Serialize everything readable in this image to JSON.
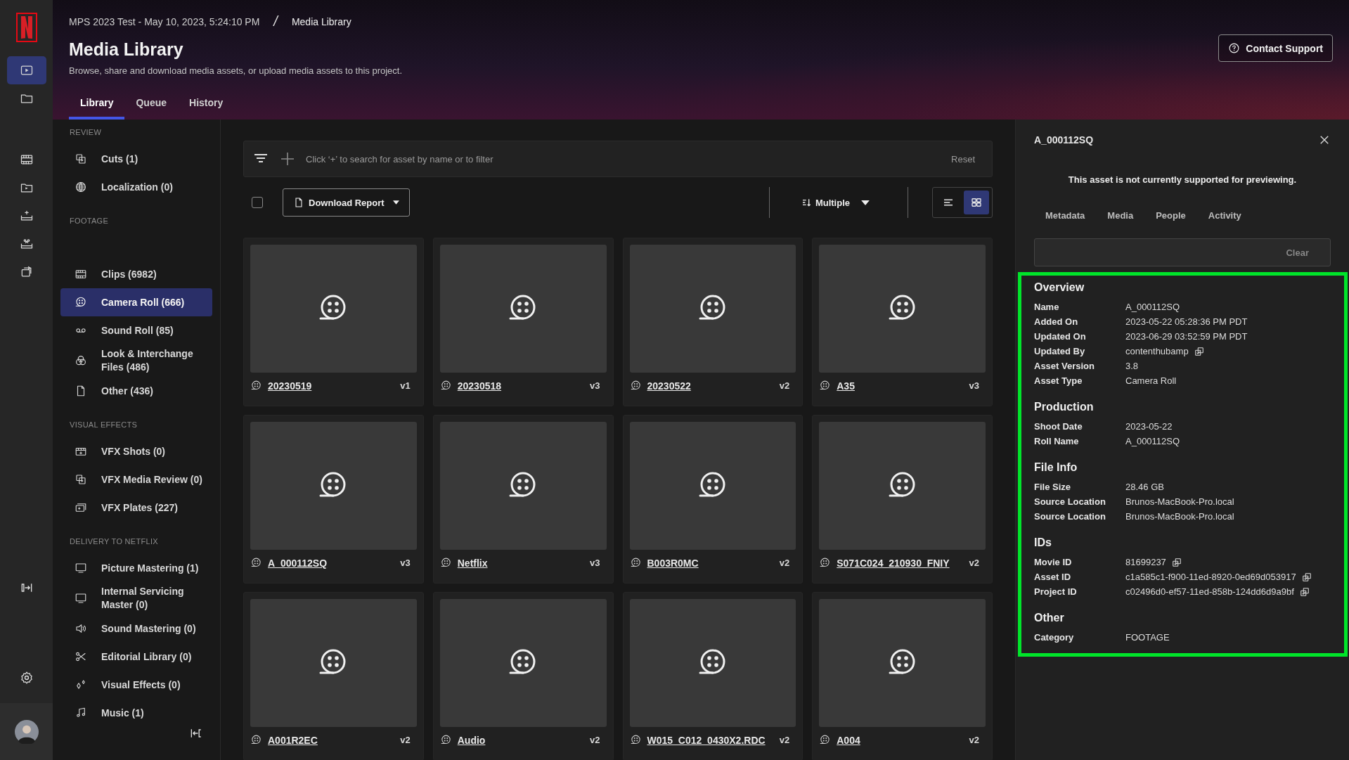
{
  "rail": {
    "items": [
      {
        "kind": "media",
        "selected": true
      },
      {
        "kind": "folder",
        "selected": false
      },
      {
        "kind": "film",
        "selected": false
      },
      {
        "kind": "folder-play",
        "selected": false
      },
      {
        "kind": "tray-sparkle",
        "selected": false
      },
      {
        "kind": "tray-scissors",
        "selected": false
      },
      {
        "kind": "export",
        "selected": false
      }
    ]
  },
  "breadcrumb": {
    "project": "MPS 2023 Test - May 10, 2023, 5:24:10 PM",
    "separator": "/",
    "current": "Media Library"
  },
  "header": {
    "title": "Media Library",
    "subtitle": "Browse, share and download media assets, or upload media assets to this project.",
    "contact_button": "Contact Support"
  },
  "tabs": [
    {
      "label": "Library",
      "selected": true
    },
    {
      "label": "Queue",
      "selected": false
    },
    {
      "label": "History",
      "selected": false
    }
  ],
  "sidebar": {
    "sections": [
      {
        "heading": "REVIEW",
        "items": [
          {
            "label": "Cuts (1)",
            "kind": "cuts",
            "selected": false
          },
          {
            "label": "Localization (0)",
            "kind": "globe",
            "selected": false
          }
        ]
      },
      {
        "heading": "FOOTAGE",
        "items": [
          {
            "label": "Clips (6982)",
            "kind": "film",
            "selected": false
          },
          {
            "label": "Camera Roll (666)",
            "kind": "reel",
            "selected": true
          },
          {
            "label": "Sound Roll (85)",
            "kind": "tape",
            "selected": false
          },
          {
            "label": "Look & Interchange Files (486)",
            "kind": "circles",
            "selected": false
          },
          {
            "label": "Other (436)",
            "kind": "file",
            "selected": false
          }
        ]
      },
      {
        "heading": "VISUAL EFFECTS",
        "items": [
          {
            "label": "VFX Shots (0)",
            "kind": "clapper",
            "selected": false
          },
          {
            "label": "VFX Media Review (0)",
            "kind": "cuts",
            "selected": false
          },
          {
            "label": "VFX Plates (227)",
            "kind": "plates",
            "selected": false
          }
        ]
      },
      {
        "heading": "DELIVERY TO NETFLIX",
        "items": [
          {
            "label": "Picture Mastering (1)",
            "kind": "monitor",
            "selected": false
          },
          {
            "label": "Internal Servicing Master (0)",
            "kind": "monitor",
            "selected": false
          },
          {
            "label": "Sound Mastering (0)",
            "kind": "speaker",
            "selected": false
          },
          {
            "label": "Editorial Library (0)",
            "kind": "scissors",
            "selected": false
          },
          {
            "label": "Visual Effects (0)",
            "kind": "sparkle",
            "selected": false
          },
          {
            "label": "Music (1)",
            "kind": "music",
            "selected": false
          }
        ]
      }
    ]
  },
  "filter_bar": {
    "placeholder": "Click ‘+’ to search for asset by name or to filter",
    "reset": "Reset"
  },
  "toolbar": {
    "select_all": {
      "checked": false
    },
    "download": "Download Report",
    "sort": "Multiple",
    "views": [
      {
        "kind": "list",
        "selected": false
      },
      {
        "kind": "grid",
        "selected": true
      }
    ]
  },
  "assets": [
    {
      "name": "20230519",
      "version": "v1"
    },
    {
      "name": "20230518",
      "version": "v3"
    },
    {
      "name": "20230522",
      "version": "v2"
    },
    {
      "name": "A35",
      "version": "v3"
    },
    {
      "name": "A_000112SQ",
      "version": "v3"
    },
    {
      "name": "Netflix",
      "version": "v3"
    },
    {
      "name": "B003R0MC",
      "version": "v2"
    },
    {
      "name": "S071C024_210930_FNIY",
      "version": "v2"
    },
    {
      "name": "A001R2EC",
      "version": "v2"
    },
    {
      "name": "Audio",
      "version": "v2"
    },
    {
      "name": "W015_C012_0430X2.RDC",
      "version": "v2"
    },
    {
      "name": "A004",
      "version": "v2"
    }
  ],
  "details": {
    "title": "A_000112SQ",
    "notice": "This asset is not currently supported for previewing.",
    "tabs": [
      "Metadata",
      "Media",
      "People",
      "Activity"
    ],
    "clear": "Clear",
    "sections": [
      {
        "heading": "Overview",
        "rows": [
          {
            "label": "Name",
            "value": "A_000112SQ",
            "copyable": false
          },
          {
            "label": "Added On",
            "value": "2023-05-22 05:28:36 PM PDT",
            "copyable": false
          },
          {
            "label": "Updated On",
            "value": "2023-06-29 03:52:59 PM PDT",
            "copyable": false
          },
          {
            "label": "Updated By",
            "value": "contenthubamp",
            "copyable": true
          },
          {
            "label": "Asset Version",
            "value": "3.8",
            "copyable": false
          },
          {
            "label": "Asset Type",
            "value": "Camera Roll",
            "copyable": false
          }
        ]
      },
      {
        "heading": "Production",
        "rows": [
          {
            "label": "Shoot Date",
            "value": "2023-05-22",
            "copyable": false
          },
          {
            "label": "Roll Name",
            "value": "A_000112SQ",
            "copyable": false
          }
        ]
      },
      {
        "heading": "File Info",
        "rows": [
          {
            "label": "File Size",
            "value": "28.46 GB",
            "copyable": false
          },
          {
            "label": "Source Location",
            "value": "Brunos-MacBook-Pro.local",
            "copyable": false
          },
          {
            "label": "Source Location",
            "value": "Brunos-MacBook-Pro.local",
            "copyable": false
          }
        ]
      },
      {
        "heading": "IDs",
        "rows": [
          {
            "label": "Movie ID",
            "value": "81699237",
            "copyable": true
          },
          {
            "label": "Asset ID",
            "value": "c1a585c1-f900-11ed-8920-0ed69d053917",
            "copyable": true
          },
          {
            "label": "Project ID",
            "value": "c02496d0-ef57-11ed-858b-124dd6d9a9bf",
            "copyable": true
          }
        ]
      },
      {
        "heading": "Other",
        "rows": [
          {
            "label": "Category",
            "value": "FOOTAGE",
            "copyable": false
          }
        ]
      }
    ]
  }
}
